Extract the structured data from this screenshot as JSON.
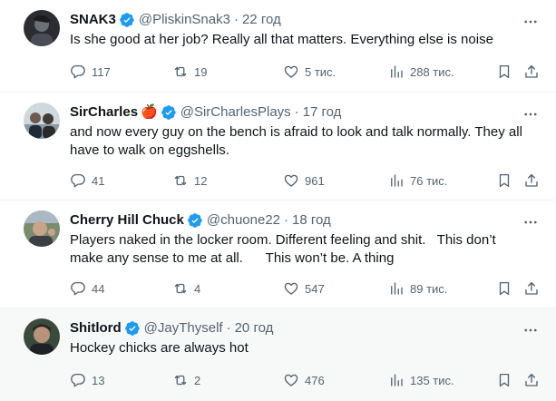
{
  "tweets": [
    {
      "name": "SNAK3",
      "handle": "@PliskinSnak3",
      "sep": "·",
      "time": "22 год",
      "emoji": "",
      "text": "Is she good at her job? Really all that matters. Everything else is noise",
      "replies": "117",
      "reposts": "19",
      "likes": "5 тис.",
      "views": "288 тис."
    },
    {
      "name": "SirCharles",
      "handle": "@SirCharlesPlays",
      "sep": "·",
      "time": "17 год",
      "emoji": "🍎",
      "text": "and now every guy on the bench is afraid to look and talk normally. They all have to walk on eggshells.",
      "replies": "41",
      "reposts": "12",
      "likes": "961",
      "views": "76 тис."
    },
    {
      "name": "Cherry Hill Chuck",
      "handle": "@chuone22",
      "sep": "·",
      "time": "18 год",
      "emoji": "",
      "text": "Players naked in the locker room. Different feeling and shit.   This don’t make any sense to me at all.      This won’t be. A thing",
      "replies": "44",
      "reposts": "4",
      "likes": "547",
      "views": "89 тис."
    },
    {
      "name": "Shitlord",
      "handle": "@JayThyself",
      "sep": "·",
      "time": "20 год",
      "emoji": "",
      "text": "Hockey chicks are always hot",
      "replies": "13",
      "reposts": "2",
      "likes": "476",
      "views": "135 тис."
    }
  ],
  "colors": {
    "accent": "#1d9bf0",
    "text": "#0f1419",
    "secondary": "#536471",
    "divider": "#eff3f4",
    "highlight": "#f7f9f9"
  },
  "icons": {
    "verified": "verified-badge-icon",
    "more": "more-dots-icon",
    "reply": "reply-icon",
    "repost": "repost-icon",
    "like": "like-heart-icon",
    "views": "views-chart-icon",
    "bookmark": "bookmark-icon",
    "share": "share-icon"
  }
}
